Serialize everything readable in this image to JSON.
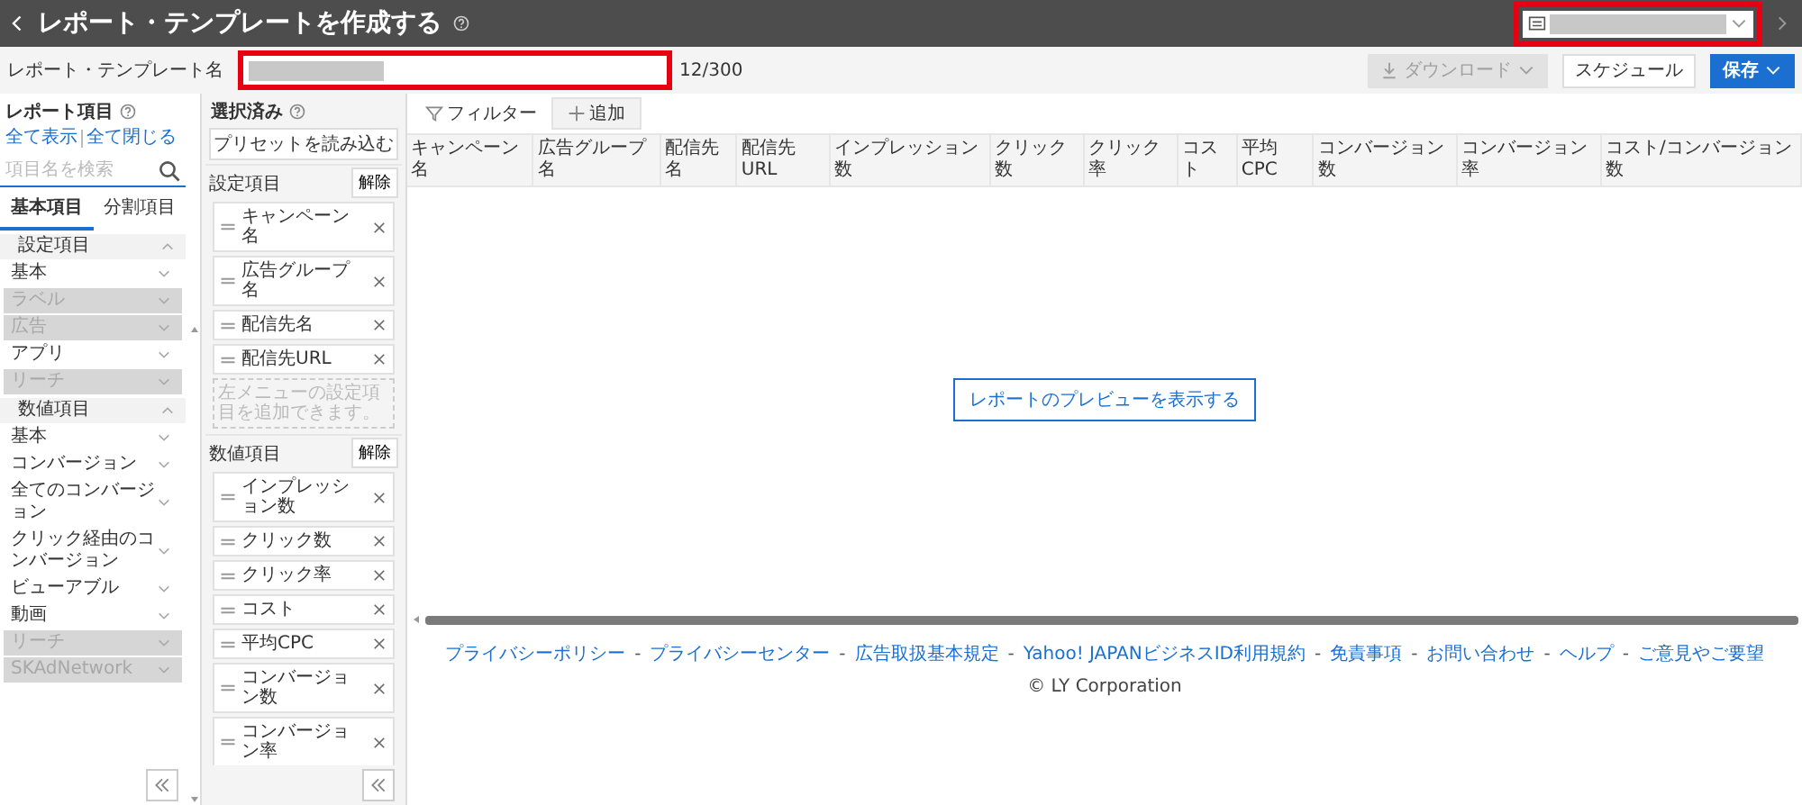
{
  "header": {
    "title": "レポート・テンプレートを作成する"
  },
  "template_bar": {
    "label": "レポート・テンプレート名",
    "counter": "12/300",
    "highlighted": true,
    "buttons": [
      {
        "label": "ダウンロード",
        "kind": "download",
        "disabled": true
      },
      {
        "label": "スケジュール",
        "kind": "plain",
        "disabled": false
      },
      {
        "label": "保存",
        "kind": "primary",
        "disabled": false
      }
    ]
  },
  "account_select": {
    "highlighted": true
  },
  "report_items": {
    "title": "レポート項目",
    "show_all": "全て表示",
    "collapse_all": "全て閉じる",
    "search": {
      "placeholder": "項目名を検索"
    },
    "tabs": [
      {
        "label": "基本項目",
        "selected": true
      },
      {
        "label": "分割項目",
        "selected": false
      }
    ],
    "sections": [
      {
        "title": "設定項目",
        "expanded": true,
        "items": [
          {
            "label": "基本",
            "disabled": false
          },
          {
            "label": "ラベル",
            "disabled": true
          },
          {
            "label": "広告",
            "disabled": true
          },
          {
            "label": "アプリ",
            "disabled": false
          },
          {
            "label": "リーチ",
            "disabled": true
          }
        ]
      },
      {
        "title": "数値項目",
        "expanded": true,
        "items": [
          {
            "label": "基本",
            "disabled": false
          },
          {
            "label": "コンバージョン",
            "disabled": false
          },
          {
            "label": "全てのコンバージョン",
            "disabled": false
          },
          {
            "label": "クリック経由のコンバージョン",
            "disabled": false
          },
          {
            "label": "ビューアブル",
            "disabled": false
          },
          {
            "label": "動画",
            "disabled": false
          },
          {
            "label": "リーチ",
            "disabled": true
          },
          {
            "label": "SKAdNetwork",
            "disabled": true
          }
        ]
      }
    ]
  },
  "selected": {
    "title": "選択済み",
    "preset_button": "プリセットを読み込む",
    "groups": [
      {
        "title": "設定項目",
        "clear": "解除",
        "chips": [
          "キャンペーン名",
          "広告グループ名",
          "配信先名",
          "配信先URL"
        ],
        "hint": "左メニューの設定項目を追加できます。"
      },
      {
        "title": "数値項目",
        "clear": "解除",
        "chips": [
          "インプレッション数",
          "クリック数",
          "クリック率",
          "コスト",
          "平均CPC",
          "コンバージョン数",
          "コンバージョン率"
        ]
      }
    ]
  },
  "preview": {
    "filter": "フィルター",
    "add": "追加",
    "columns": [
      "キャンペーン名",
      "広告グループ名",
      "配信先名",
      "配信先URL",
      "インプレッション数",
      "クリック数",
      "クリック率",
      "コスト",
      "平均CPC",
      "コンバージョン数",
      "コンバージョン率",
      "コスト/コンバージョン数"
    ],
    "preview_button": "レポートのプレビューを表示する"
  },
  "footer": {
    "links": [
      "プライバシーポリシー",
      "プライバシーセンター",
      "広告取扱基本規定",
      "Yahoo! JAPANビジネスID利用規約",
      "免責事項",
      "お問い合わせ",
      "ヘルプ",
      "ご意見やご要望"
    ],
    "separator": "-",
    "copyright": "© LY Corporation"
  }
}
